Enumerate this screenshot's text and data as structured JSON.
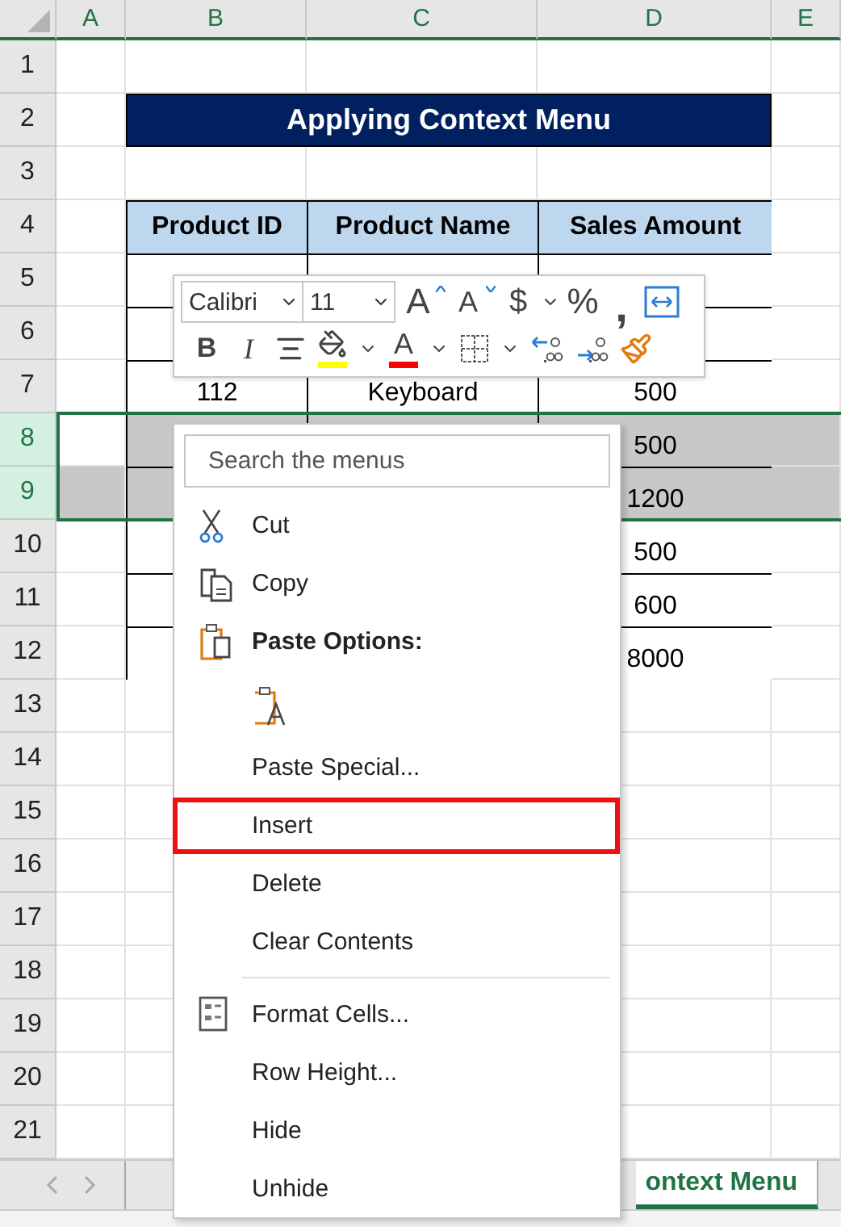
{
  "columns": [
    {
      "label": "A"
    },
    {
      "label": "B"
    },
    {
      "label": "C"
    },
    {
      "label": "D"
    },
    {
      "label": "E"
    }
  ],
  "row_headers": [
    {
      "label": "1",
      "selected": false
    },
    {
      "label": "2",
      "selected": false
    },
    {
      "label": "3",
      "selected": false
    },
    {
      "label": "4",
      "selected": false
    },
    {
      "label": "5",
      "selected": false
    },
    {
      "label": "6",
      "selected": false
    },
    {
      "label": "7",
      "selected": false
    },
    {
      "label": "8",
      "selected": true
    },
    {
      "label": "9",
      "selected": true
    },
    {
      "label": "10",
      "selected": false
    },
    {
      "label": "11",
      "selected": false
    },
    {
      "label": "12",
      "selected": false
    },
    {
      "label": "13",
      "selected": false
    },
    {
      "label": "14",
      "selected": false
    },
    {
      "label": "15",
      "selected": false
    },
    {
      "label": "16",
      "selected": false
    },
    {
      "label": "17",
      "selected": false
    },
    {
      "label": "18",
      "selected": false
    },
    {
      "label": "19",
      "selected": false
    },
    {
      "label": "20",
      "selected": false
    },
    {
      "label": "21",
      "selected": false
    }
  ],
  "title": "Applying Context Menu",
  "table": {
    "columns": [
      "Product ID",
      "Product Name",
      "Sales Amount"
    ],
    "rows": [
      {},
      {},
      {
        "product_id": "112",
        "product_name": "Keyboard",
        "sales_amount": "500"
      },
      {
        "sales_amount": "500"
      },
      {
        "sales_amount": "1200"
      },
      {
        "sales_amount": "500"
      },
      {
        "sales_amount": "600"
      },
      {
        "sales_amount": "8000"
      }
    ]
  },
  "mini_toolbar": {
    "font": "Calibri",
    "size": "11",
    "row_1": [
      {
        "kind": "grow",
        "label": "A"
      },
      {
        "kind": "shrink",
        "label": "A"
      },
      {
        "kind": "currency",
        "label": "$"
      },
      {
        "kind": "percent",
        "label": "%"
      },
      {
        "kind": "comma",
        "label": ","
      },
      {
        "kind": "wrap"
      }
    ],
    "row_2": [
      {
        "kind": "bold",
        "label": "B"
      },
      {
        "kind": "italic",
        "label": "I"
      },
      {
        "kind": "align"
      },
      {
        "kind": "fill",
        "color": "#ffff00"
      },
      {
        "kind": "font_color",
        "label": "A",
        "color": "#ff0000"
      },
      {
        "kind": "borders"
      },
      {
        "kind": "increase_decimal"
      },
      {
        "kind": "decrease_decimal"
      },
      {
        "kind": "format_painter"
      }
    ]
  },
  "context_menu": {
    "search": {
      "placeholder": "Search the menus"
    },
    "items": [
      {
        "kind": "cut",
        "label": "Cut",
        "highlighted": false
      },
      {
        "kind": "copy",
        "label": "Copy",
        "highlighted": false
      },
      {
        "kind": "heading",
        "label": "Paste Options:"
      },
      {
        "kind": "paste_option"
      },
      {
        "kind": "command",
        "label": "Paste Special...",
        "highlighted": false
      },
      {
        "kind": "command",
        "label": "Insert",
        "highlighted": true
      },
      {
        "kind": "command",
        "label": "Delete",
        "highlighted": false
      },
      {
        "kind": "command",
        "label": "Clear Contents",
        "highlighted": false
      },
      {
        "kind": "separator"
      },
      {
        "kind": "format",
        "label": "Format Cells...",
        "highlighted": false
      },
      {
        "kind": "command",
        "label": "Row Height...",
        "highlighted": false
      },
      {
        "kind": "command",
        "label": "Hide",
        "highlighted": false
      },
      {
        "kind": "command",
        "label": "Unhide",
        "highlighted": false
      }
    ]
  },
  "sheet_tabs": [
    {
      "label": "ontext Menu",
      "selected": true
    }
  ]
}
